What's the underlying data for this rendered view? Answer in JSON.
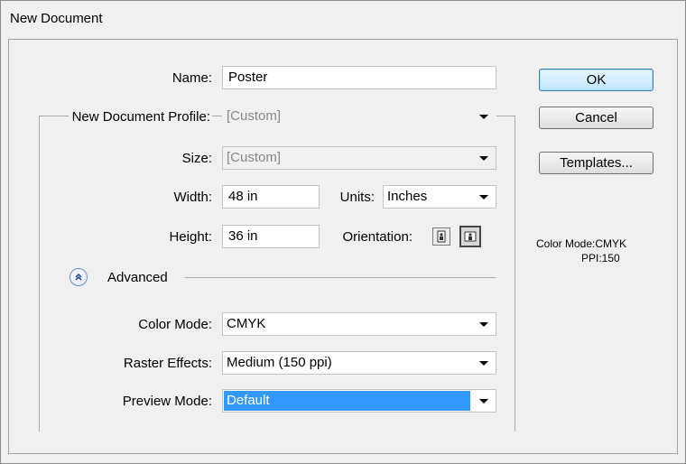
{
  "window": {
    "title": "New Document"
  },
  "form": {
    "name_label": "Name:",
    "name_value": "Poster",
    "profile_label": "New Document Profile:",
    "profile_value": "[Custom]",
    "size_label": "Size:",
    "size_value": "[Custom]",
    "width_label": "Width:",
    "width_value": "48 in",
    "units_label": "Units:",
    "units_value": "Inches",
    "height_label": "Height:",
    "height_value": "36 in",
    "orientation_label": "Orientation:",
    "advanced_label": "Advanced",
    "color_mode_label": "Color Mode:",
    "color_mode_value": "CMYK",
    "raster_label": "Raster Effects:",
    "raster_value": "Medium (150 ppi)",
    "preview_label": "Preview Mode:",
    "preview_value": "Default"
  },
  "buttons": {
    "ok": "OK",
    "cancel": "Cancel",
    "templates": "Templates..."
  },
  "info": {
    "color_mode": "Color Mode:CMYK",
    "ppi": "PPI:150"
  },
  "colors": {
    "selection": "#3399ff",
    "panel": "#f0f0f0",
    "default_button": "#bee6fd"
  },
  "icons": {
    "orientation_portrait": "portrait-orientation-icon",
    "orientation_landscape": "landscape-orientation-icon",
    "advanced_toggle": "collapse-double-chevron-icon",
    "dropdown": "chevron-down-icon"
  }
}
